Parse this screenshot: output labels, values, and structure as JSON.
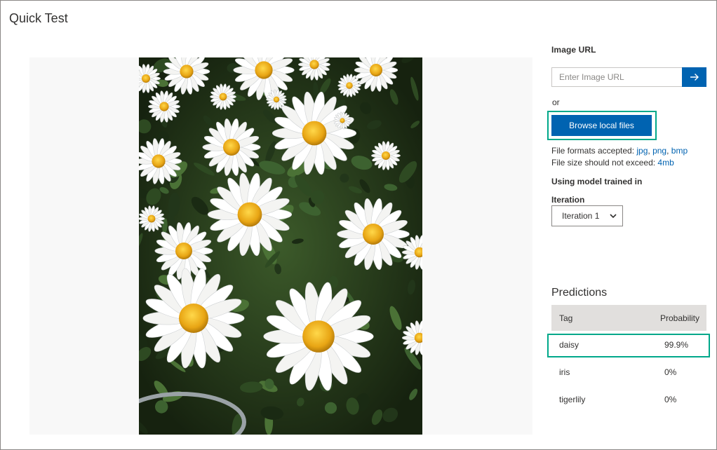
{
  "page": {
    "title": "Quick Test"
  },
  "image_url": {
    "label": "Image URL",
    "placeholder": "Enter Image URL",
    "submit_icon": "arrow-right-icon"
  },
  "or_text": "or",
  "browse_label": "Browse local files",
  "formats": {
    "prefix": "File formats accepted: ",
    "jpg": "jpg",
    "sep1": ", ",
    "png": "png",
    "sep2": ", ",
    "bmp": "bmp"
  },
  "size": {
    "prefix": "File size should not exceed: ",
    "value": "4mb"
  },
  "model": {
    "label": "Using model trained in",
    "iteration_label": "Iteration",
    "iteration_value": "Iteration 1"
  },
  "predictions": {
    "title": "Predictions",
    "columns": {
      "tag": "Tag",
      "probability": "Probability"
    },
    "rows": [
      {
        "tag": "daisy",
        "probability": "99.9%"
      },
      {
        "tag": "iris",
        "probability": "0%"
      },
      {
        "tag": "tigerlily",
        "probability": "0%"
      }
    ]
  },
  "colors": {
    "accent": "#0063b1",
    "highlight": "#00a88a"
  }
}
